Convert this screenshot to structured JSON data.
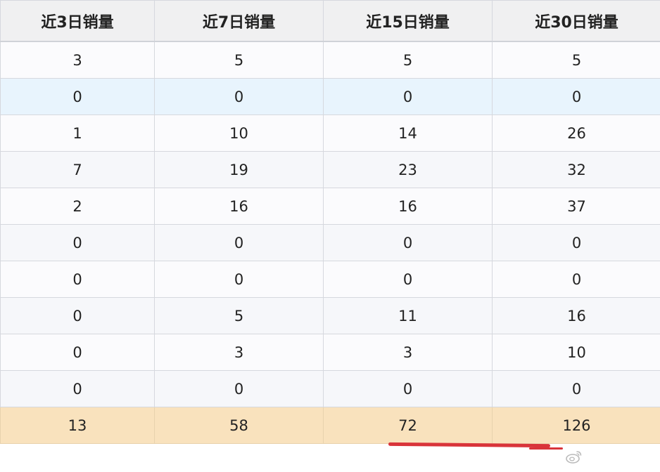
{
  "table": {
    "headers": [
      "近3日销量",
      "近7日销量",
      "近15日销量",
      "近30日销量"
    ],
    "rows": [
      [
        "3",
        "5",
        "5",
        "5"
      ],
      [
        "0",
        "0",
        "0",
        "0"
      ],
      [
        "1",
        "10",
        "14",
        "26"
      ],
      [
        "7",
        "19",
        "23",
        "32"
      ],
      [
        "2",
        "16",
        "16",
        "37"
      ],
      [
        "0",
        "0",
        "0",
        "0"
      ],
      [
        "0",
        "0",
        "0",
        "0"
      ],
      [
        "0",
        "5",
        "11",
        "16"
      ],
      [
        "0",
        "3",
        "3",
        "10"
      ],
      [
        "0",
        "0",
        "0",
        "0"
      ]
    ],
    "totals": [
      "13",
      "58",
      "72",
      "126"
    ],
    "selected_row": 1
  },
  "colors": {
    "header_bg": "#f0f0f1",
    "selected_row_bg": "#e8f4fd",
    "totals_bg": "#f9e2bd",
    "annotation_red": "#d9343a"
  },
  "watermark": {
    "icon": "weibo-icon"
  }
}
